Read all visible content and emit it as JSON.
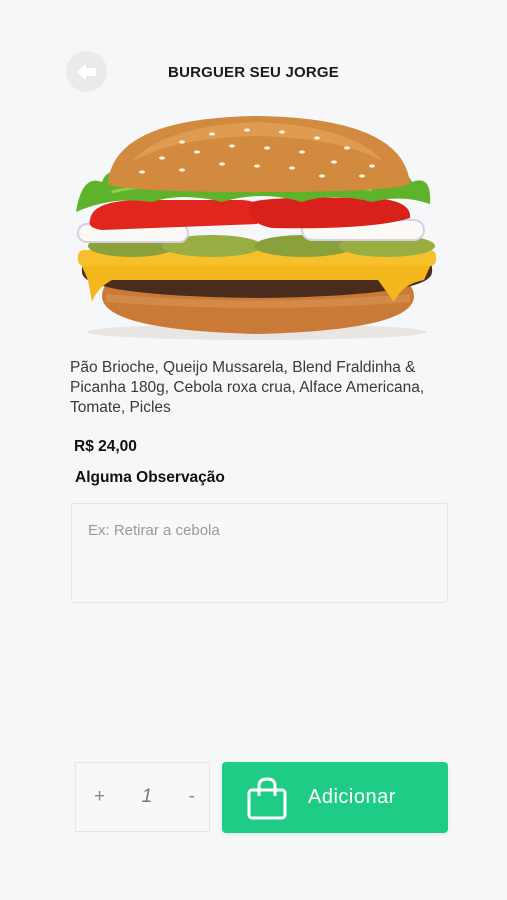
{
  "header": {
    "title": "BURGUER SEU JORGE",
    "back_icon": "arrow-left-icon"
  },
  "product": {
    "image": "burger-image",
    "description": "Pão Brioche, Queijo Mussarela, Blend Fraldinha & Picanha 180g, Cebola roxa crua, Alface Americana, Tomate, Picles",
    "price": "R$ 24,00"
  },
  "observation": {
    "label": "Alguma Observação",
    "placeholder": "Ex: Retirar a cebola",
    "value": ""
  },
  "quantity": {
    "increment_label": "+",
    "value": "1",
    "decrement_label": "-"
  },
  "add_button": {
    "label": "Adicionar",
    "icon": "shopping-bag-icon",
    "color": "#1ecc86"
  }
}
